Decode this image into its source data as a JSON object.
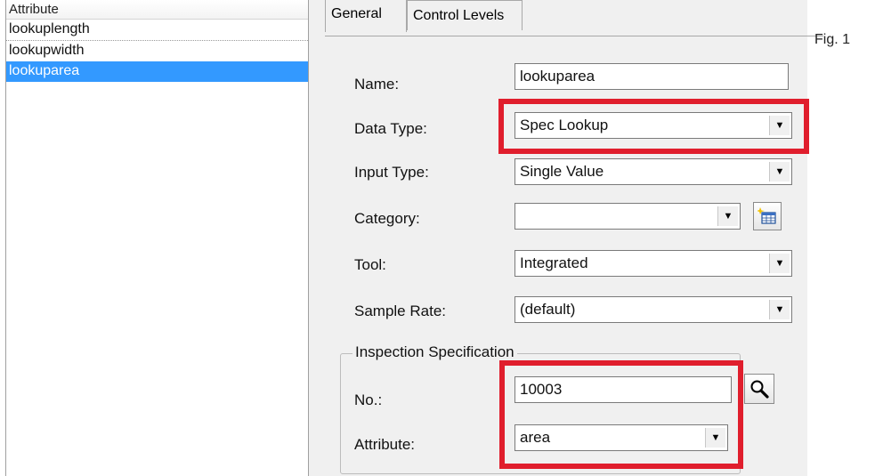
{
  "list": {
    "header": "Attribute",
    "items": [
      "lookuplength",
      "lookupwidth",
      "lookuparea"
    ],
    "selected_index": 2
  },
  "tabs": [
    "General",
    "Control Levels"
  ],
  "active_tab": "General",
  "form": {
    "name_label": "Name:",
    "name_value": "lookuparea",
    "data_type_label": "Data Type:",
    "data_type_value": "Spec Lookup",
    "input_type_label": "Input Type:",
    "input_type_value": "Single Value",
    "category_label": "Category:",
    "category_value": "",
    "tool_label": "Tool:",
    "tool_value": "Integrated",
    "sample_rate_label": "Sample Rate:",
    "sample_rate_value": "(default)"
  },
  "inspection": {
    "group_title": "Inspection Specification",
    "no_label": "No.:",
    "no_value": "10003",
    "attribute_label": "Attribute:",
    "attribute_value": "area"
  },
  "figure_label": "Fig. 1",
  "colors": {
    "highlight": "#e01e2d",
    "selection": "#3399ff",
    "dialog_bg": "#f0f0f0"
  }
}
